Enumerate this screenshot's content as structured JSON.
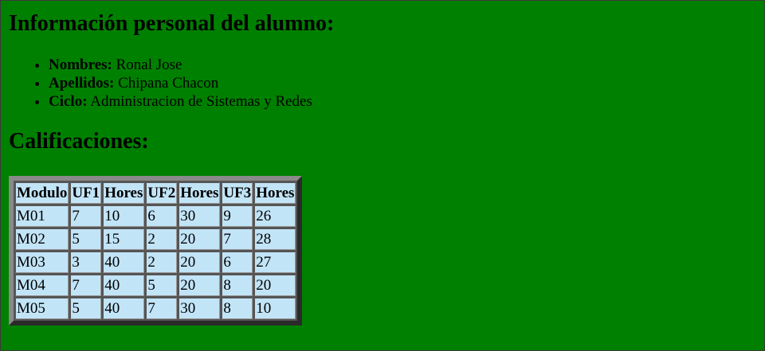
{
  "page": {
    "title": "Información personal del alumno:",
    "grades_title": "Calificaciones:"
  },
  "student": {
    "names_label": "Nombres:",
    "names_value": " Ronal Jose",
    "surnames_label": "Apellidos:",
    "surnames_value": " Chipana Chacon",
    "cycle_label": "Ciclo:",
    "cycle_value": " Administracion de Sistemas y Redes"
  },
  "table": {
    "headers": [
      "Modulo",
      "UF1",
      "Hores",
      "UF2",
      "Hores",
      "UF3",
      "Hores"
    ],
    "rows": [
      [
        "M01",
        "7",
        "10",
        "6",
        "30",
        "9",
        "26"
      ],
      [
        "M02",
        "5",
        "15",
        "2",
        "20",
        "7",
        "28"
      ],
      [
        "M03",
        "3",
        "40",
        "2",
        "20",
        "6",
        "27"
      ],
      [
        "M04",
        "7",
        "40",
        "5",
        "20",
        "8",
        "20"
      ],
      [
        "M05",
        "5",
        "40",
        "7",
        "30",
        "8",
        "10"
      ]
    ]
  },
  "colors": {
    "page_background": "#008000",
    "cell_background": "#c2e4f7"
  }
}
